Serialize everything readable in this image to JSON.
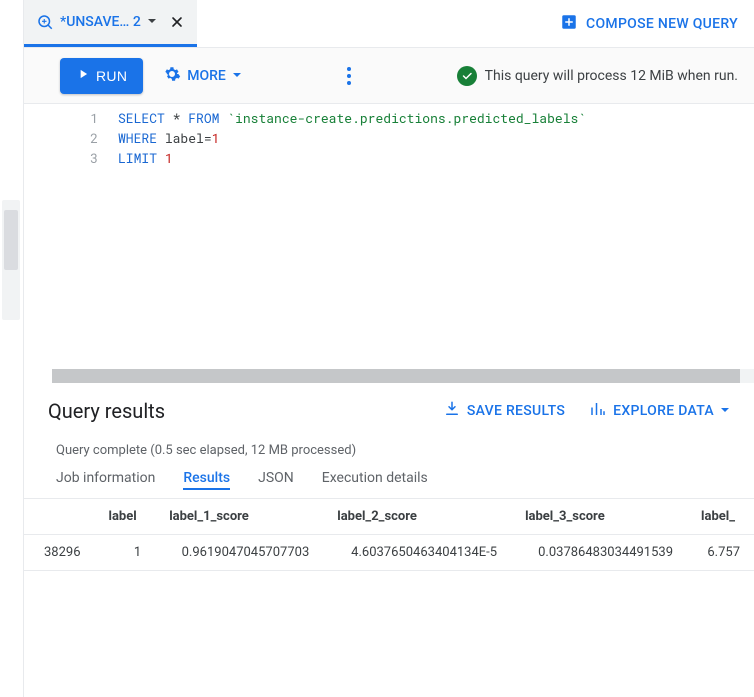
{
  "tab": {
    "label": "*UNSAVE… 2"
  },
  "compose_label": "COMPOSE NEW QUERY",
  "toolbar": {
    "run_label": "RUN",
    "more_label": "MORE",
    "status_text": "This query will process 12 MiB when run."
  },
  "editor": {
    "lines": [
      "1",
      "2",
      "3"
    ],
    "code": {
      "l1a": "SELECT",
      "l1b": " * ",
      "l1c": "FROM",
      "l1d": " `instance-create.predictions.predicted_labels`",
      "l2a": "WHERE",
      "l2b": " label=",
      "l2c": "1",
      "l3a": "LIMIT",
      "l3b": " ",
      "l3c": "1"
    }
  },
  "results": {
    "title": "Query results",
    "save_label": "SAVE RESULTS",
    "explore_label": "EXPLORE DATA",
    "complete_text": "Query complete (0.5 sec elapsed, 12 MB processed)",
    "tabs": {
      "job": "Job information",
      "results": "Results",
      "json": "JSON",
      "exec": "Execution details"
    },
    "columns": {
      "c0": "",
      "c1": "label",
      "c2": "label_1_score",
      "c3": "label_2_score",
      "c4": "label_3_score",
      "c5": "label_"
    },
    "row": {
      "id": "38296",
      "label": "1",
      "s1": "0.9619047045707703",
      "s2": "4.6037650463404134E-5",
      "s3": "0.03786483034491539",
      "s4": "6.757"
    }
  }
}
